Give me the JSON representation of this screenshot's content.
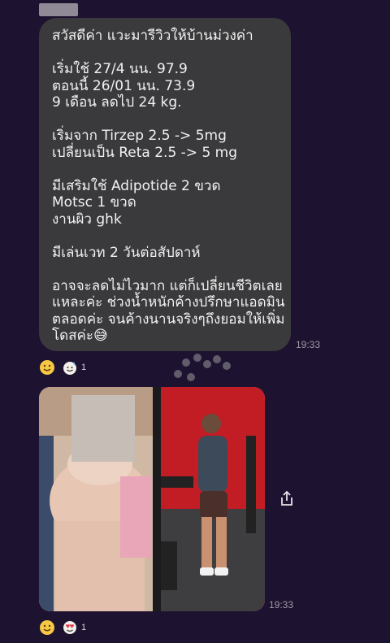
{
  "message": {
    "lines": [
      "สวัสดีค่า แวะมารีวิวให้บ้านม่วงค่า",
      "",
      "เริ่มใช้ 27/4 นน. 97.9",
      "ตอนนี้ 26/01 นน. 73.9",
      "9 เดือน ลดไป 24 kg.",
      "",
      "เริ่มจาก Tirzep 2.5 -> 5mg",
      "เปลี่ยนเป็น Reta 2.5 -> 5 mg",
      "",
      "มีเสริมใช้ Adipotide 2 ขวด",
      "Motsc 1 ขวด",
      "งานผิว ghk",
      "",
      "มีเล่นเวท 2 วันต่อสัปดาห์",
      "",
      "อาจจะลดไม่ไวมาก แต่ก็เปลี่ยนชีวิตเลย",
      "แหละค่ะ ช่วงน้ำหนักค้างปรึกษาแอดมิน",
      "ตลอดค่ะ จนค้างนานจริงๆถึงยอมให้เพิ่ม",
      "โดสค่ะ😅"
    ],
    "time": "19:33",
    "reactions": {
      "icons": [
        "smile-face-icon",
        "sweat-smile-emoji-icon"
      ],
      "count": "1"
    }
  },
  "photo_message": {
    "time": "19:33",
    "reactions": {
      "icons": [
        "smile-face-icon",
        "heart-eyes-emoji-icon"
      ],
      "count": "1"
    }
  },
  "colors": {
    "background": "#1d1230",
    "bubble": "#3a3a3c",
    "text": "#f2f2f2",
    "timestamp": "#9f9aa8",
    "reaction_yellow": "#f6c844"
  }
}
